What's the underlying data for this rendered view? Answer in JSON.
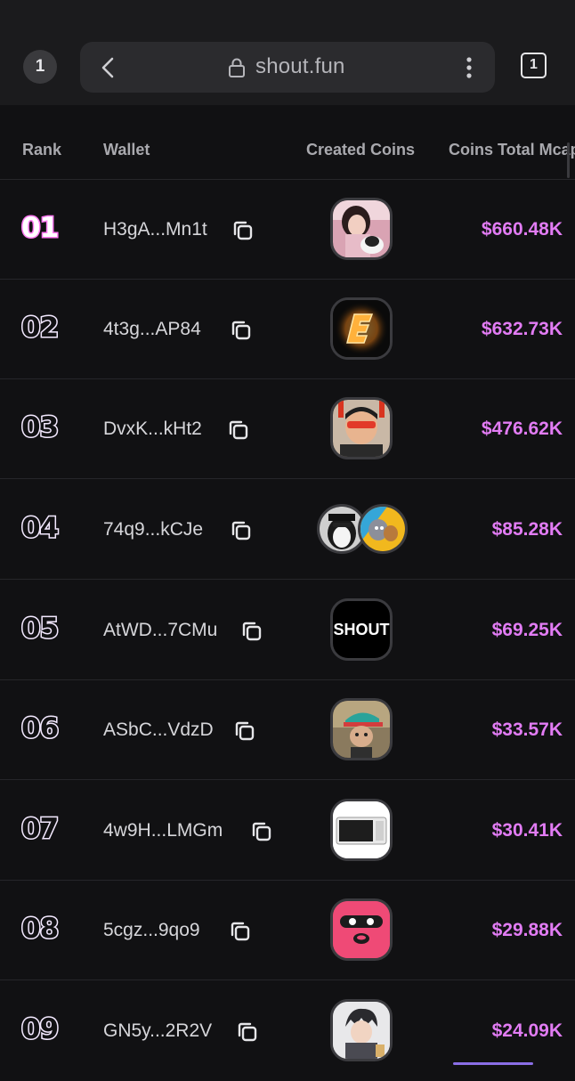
{
  "browser": {
    "left_tab_count": "1",
    "url": "shout.fun",
    "tabs_count": "1"
  },
  "table": {
    "headers": {
      "rank": "Rank",
      "wallet": "Wallet",
      "created": "Created Coins",
      "mcap": "Coins Total Mcap"
    },
    "rows": [
      {
        "rank": "01",
        "wallet": "H3gA...Mn1t",
        "mcap": "$660.48K",
        "coins": [
          "girl-with-cat-avatar"
        ]
      },
      {
        "rank": "02",
        "wallet": "4t3g...AP84",
        "mcap": "$632.73K",
        "coins": [
          "glowing-e-logo"
        ]
      },
      {
        "rank": "03",
        "wallet": "DvxK...kHt2",
        "mcap": "$476.62K",
        "coins": [
          "man-with-sunglasses-avatar"
        ]
      },
      {
        "rank": "04",
        "wallet": "74q9...kCJe",
        "mcap": "$85.28K",
        "coins": [
          "penguin-avatar",
          "cartoon-cat-mouse-avatar"
        ]
      },
      {
        "rank": "05",
        "wallet": "AtWD...7CMu",
        "mcap": "$69.25K",
        "coins": [
          "shout-logo"
        ],
        "coin_text": "SHOUT"
      },
      {
        "rank": "06",
        "wallet": "ASbC...VdzD",
        "mcap": "$33.57K",
        "coins": [
          "character-with-cap-avatar"
        ]
      },
      {
        "rank": "07",
        "wallet": "4w9H...LMGm",
        "mcap": "$30.41K",
        "coins": [
          "microwave-avatar"
        ]
      },
      {
        "rank": "08",
        "wallet": "5cgz...9qo9",
        "mcap": "$29.88K",
        "coins": [
          "pink-mask-face-avatar"
        ]
      },
      {
        "rank": "09",
        "wallet": "GN5y...2R2V",
        "mcap": "$24.09K",
        "coins": [
          "anime-boy-avatar"
        ]
      }
    ]
  },
  "colors": {
    "accent_pink": "#e27cf4",
    "rank_first_glow": "#ff7cf3",
    "background": "#111113"
  }
}
